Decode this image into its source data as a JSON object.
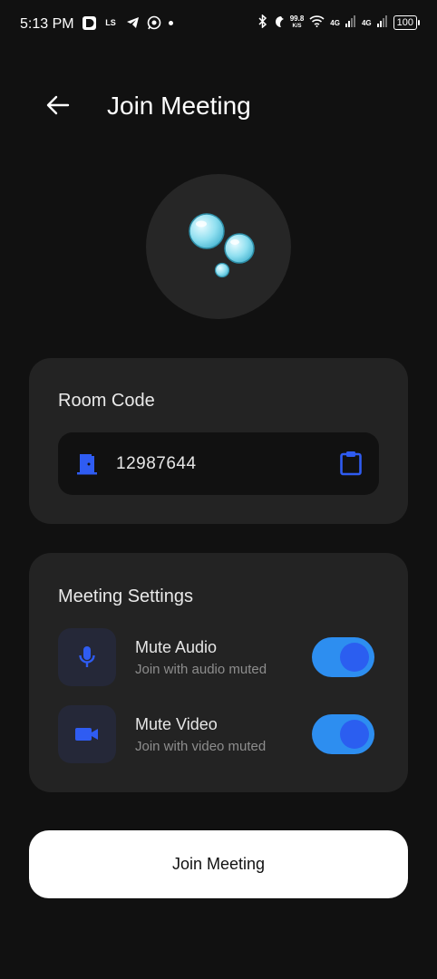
{
  "status_bar": {
    "time": "5:13 PM",
    "net_speed": "99.8",
    "net_unit": "K/S",
    "signal1": "4G",
    "signal2": "4G",
    "battery": "100",
    "icons": [
      "d-app-icon",
      "ls-icon",
      "telegram-icon",
      "whatsapp-icon",
      "dot-icon",
      "bluetooth-icon",
      "moon-icon",
      "wifi-icon"
    ]
  },
  "header": {
    "title": "Join Meeting",
    "back_icon": "arrow-left-icon"
  },
  "logo": {
    "icon": "bubbles-icon"
  },
  "room": {
    "title": "Room Code",
    "value": "12987644",
    "door_icon": "door-icon",
    "clipboard_icon": "clipboard-icon"
  },
  "settings": {
    "title": "Meeting Settings",
    "items": [
      {
        "label": "Mute Audio",
        "sub": "Join with audio muted",
        "icon": "microphone-icon",
        "enabled": true
      },
      {
        "label": "Mute Video",
        "sub": "Join with video muted",
        "icon": "video-camera-icon",
        "enabled": true
      }
    ]
  },
  "join_button": {
    "label": "Join Meeting"
  },
  "colors": {
    "background": "#111111",
    "card": "#232323",
    "accent": "#2d8ef0",
    "accent_icon": "#2f5cf2"
  }
}
